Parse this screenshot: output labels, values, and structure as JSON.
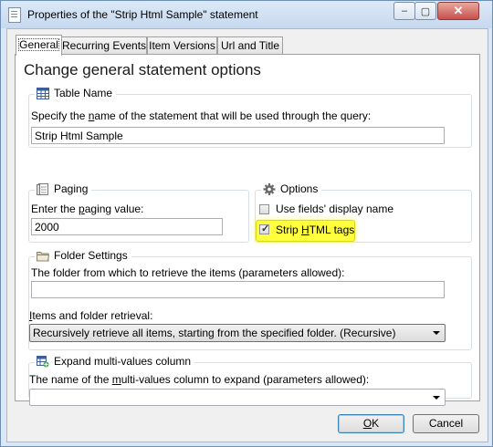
{
  "window": {
    "title": "Properties of the \"Strip Html Sample\" statement",
    "controls": {
      "minimize": "‒",
      "maximize": "▢",
      "close": "✕"
    }
  },
  "tabs": [
    {
      "label": "General",
      "active": true
    },
    {
      "label": "Recurring Events",
      "active": false
    },
    {
      "label": "Item Versions",
      "active": false
    },
    {
      "label": "Url and Title",
      "active": false
    }
  ],
  "heading": "Change general statement options",
  "table_name": {
    "group_title": "Table Name",
    "icon": "table-icon",
    "description_pre": "Specify the ",
    "description_key": "n",
    "description_post": "ame of the statement that will be used through the query:",
    "value": "Strip Html Sample"
  },
  "paging": {
    "group_title": "Paging",
    "icon": "page-icon",
    "label_pre": "Enter the ",
    "label_key": "p",
    "label_post": "aging value:",
    "value": "2000"
  },
  "options": {
    "group_title": "Options",
    "icon": "gear-icon",
    "use_display_name": {
      "label": "Use fields' display name",
      "checked": false
    },
    "strip_html": {
      "label_pre": "Strip ",
      "label_key": "H",
      "label_post": "TML tags",
      "checked": true,
      "highlight_color": "#ffff3e"
    }
  },
  "folder_settings": {
    "group_title": "Folder Settings",
    "icon": "folder-icon",
    "folder_label": "The folder from which to retrieve the items (parameters allowed):",
    "folder_value": "",
    "retrieval_label_key": "I",
    "retrieval_label_post": "tems and folder retrieval:",
    "retrieval_value": "Recursively retrieve all items, starting from the specified folder. (Recursive)"
  },
  "expand": {
    "group_title": "Expand multi-values column",
    "icon": "expand-table-icon",
    "label_pre": "The name of the ",
    "label_key": "m",
    "label_post": "ulti-values column to expand (parameters allowed):",
    "value": ""
  },
  "buttons": {
    "ok_key": "O",
    "ok_rest": "K",
    "cancel": "Cancel"
  }
}
